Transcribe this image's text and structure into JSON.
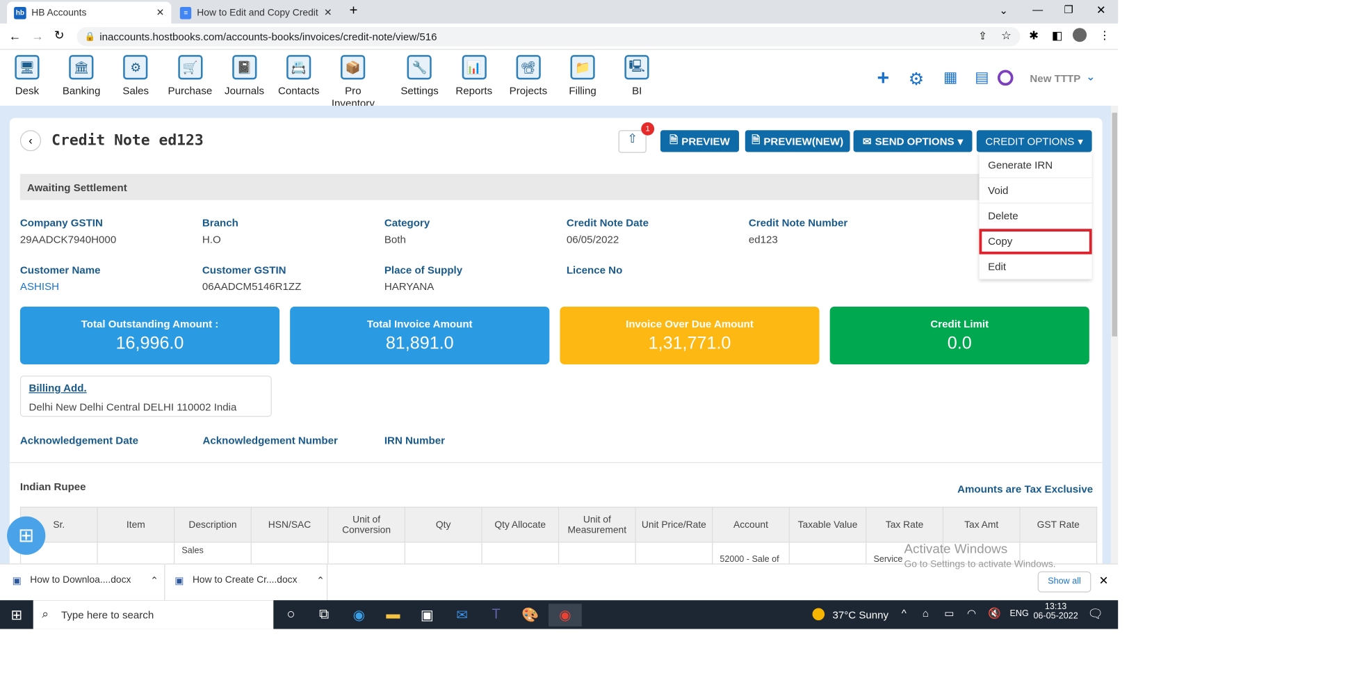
{
  "browser": {
    "tabs": [
      {
        "label": "HB Accounts",
        "icon": "hb"
      },
      {
        "label": "How to Edit and Copy Credit Not"
      }
    ],
    "url": "inaccounts.hostbooks.com/accounts-books/invoices/credit-note/view/516"
  },
  "nav": {
    "items": [
      "Desk",
      "Banking",
      "Sales",
      "Purchase",
      "Journals",
      "Contacts",
      "Pro Inventory",
      "Settings",
      "Reports",
      "Projects",
      "Filling",
      "BI"
    ],
    "company": "New TTTP"
  },
  "page": {
    "title": "Credit Note ed123",
    "notification_count": "1",
    "buttons": {
      "preview": "PREVIEW",
      "preview_new": "PREVIEW(NEW)",
      "send": "SEND OPTIONS",
      "credit": "CREDIT OPTIONS"
    },
    "menu": [
      "Generate IRN",
      "Void",
      "Delete",
      "Copy",
      "Edit"
    ],
    "status": "Awaiting Settlement",
    "fields": [
      {
        "label": "Company GSTIN",
        "value": "29AADCK7940H000"
      },
      {
        "label": "Branch",
        "value": "H.O"
      },
      {
        "label": "Category",
        "value": "Both"
      },
      {
        "label": "Credit Note Date",
        "value": "06/05/2022"
      },
      {
        "label": "Credit Note Number",
        "value": "ed123"
      },
      {
        "label": "Customer Name",
        "value": "ASHISH"
      },
      {
        "label": "Customer GSTIN",
        "value": "06AADCM5146R1ZZ"
      },
      {
        "label": "Place of Supply",
        "value": "HARYANA"
      },
      {
        "label": "Licence No",
        "value": ""
      }
    ],
    "kpis": [
      {
        "label": "Total Outstanding Amount :",
        "value": "16,996.0",
        "color": "#2a9be3"
      },
      {
        "label": "Total Invoice Amount",
        "value": "81,891.0",
        "color": "#2a9be3"
      },
      {
        "label": "Invoice Over Due Amount",
        "value": "1,31,771.0",
        "color": "#fdb813"
      },
      {
        "label": "Credit Limit",
        "value": "0.0",
        "color": "#00a84f"
      }
    ],
    "billing": {
      "title": "Billing Add.",
      "address": "Delhi New Delhi Central DELHI 110002 India"
    },
    "ack": [
      "Acknowledgement Date",
      "Acknowledgement Number",
      "IRN Number"
    ],
    "currency": "Indian Rupee",
    "tax_note": "Amounts are Tax Exclusive",
    "table": {
      "headers": [
        "Sr.",
        "Item",
        "Description",
        "HSN/SAC",
        "Unit of Conversion",
        "Qty",
        "Qty Allocate",
        "Unit of Measurement",
        "Unit Price/Rate",
        "Account",
        "Taxable Value",
        "Tax Rate",
        "Tax Amt",
        "GST Rate"
      ],
      "row": [
        "",
        "",
        "Sales",
        "",
        "",
        "",
        "",
        "",
        "",
        "52000 - Sale of",
        "",
        "Service",
        "",
        ""
      ]
    }
  },
  "watermark": {
    "title": "Activate Windows",
    "sub": "Go to Settings to activate Windows."
  },
  "downloads": {
    "items": [
      "How to Downloa....docx",
      "How to Create Cr....docx"
    ],
    "show_all": "Show all"
  },
  "taskbar": {
    "search": "Type here to search",
    "weather": "37°C  Sunny",
    "lang": "ENG",
    "time": "13:13",
    "date": "06-05-2022"
  }
}
